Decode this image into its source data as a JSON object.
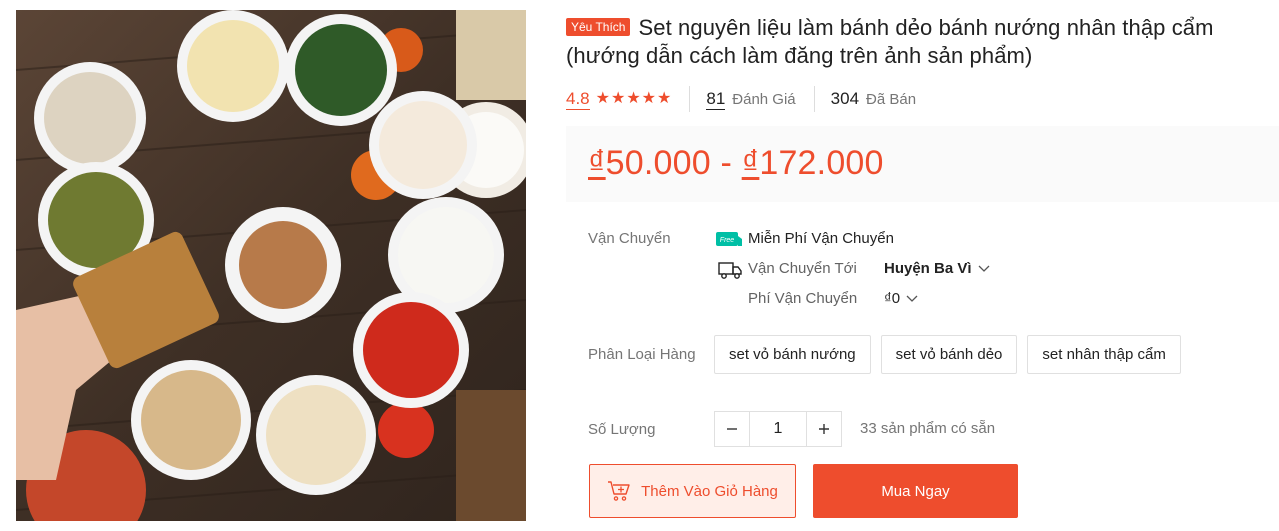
{
  "product": {
    "badge": "Yêu Thích",
    "title": "Set nguyên liệu làm bánh dẻo bánh nướng nhân thập cẩm (hướng dẫn cách làm đăng trên ảnh sản phẩm)",
    "rating": "4.8",
    "stars": 5,
    "reviews_count": "81",
    "reviews_label": "Đánh Giá",
    "sold_count": "304",
    "sold_label": "Đã Bán",
    "price_currency": "₫",
    "price_min": "50.000",
    "price_sep": " - ",
    "price_max": "172.000"
  },
  "shipping": {
    "label": "Vận Chuyển",
    "free_badge": "Free",
    "free_text": "Miễn Phí Vận Chuyển",
    "ship_to_label": "Vận Chuyển Tới",
    "ship_to_value": "Huyện Ba Vì",
    "fee_label": "Phí Vận Chuyển",
    "fee_value": "₫0"
  },
  "variants": {
    "label": "Phân Loại Hàng",
    "options": [
      "set vỏ bánh nướng",
      "set vỏ bánh dẻo",
      "set nhân thập cẩm"
    ]
  },
  "quantity": {
    "label": "Số Lượng",
    "value": "1",
    "stock": "33 sản phẩm có sẵn"
  },
  "actions": {
    "add_to_cart": "Thêm Vào Giỏ Hàng",
    "buy_now": "Mua Ngay"
  },
  "colors": {
    "accent": "#ee4d2d",
    "free_ship": "#00bfa5"
  }
}
